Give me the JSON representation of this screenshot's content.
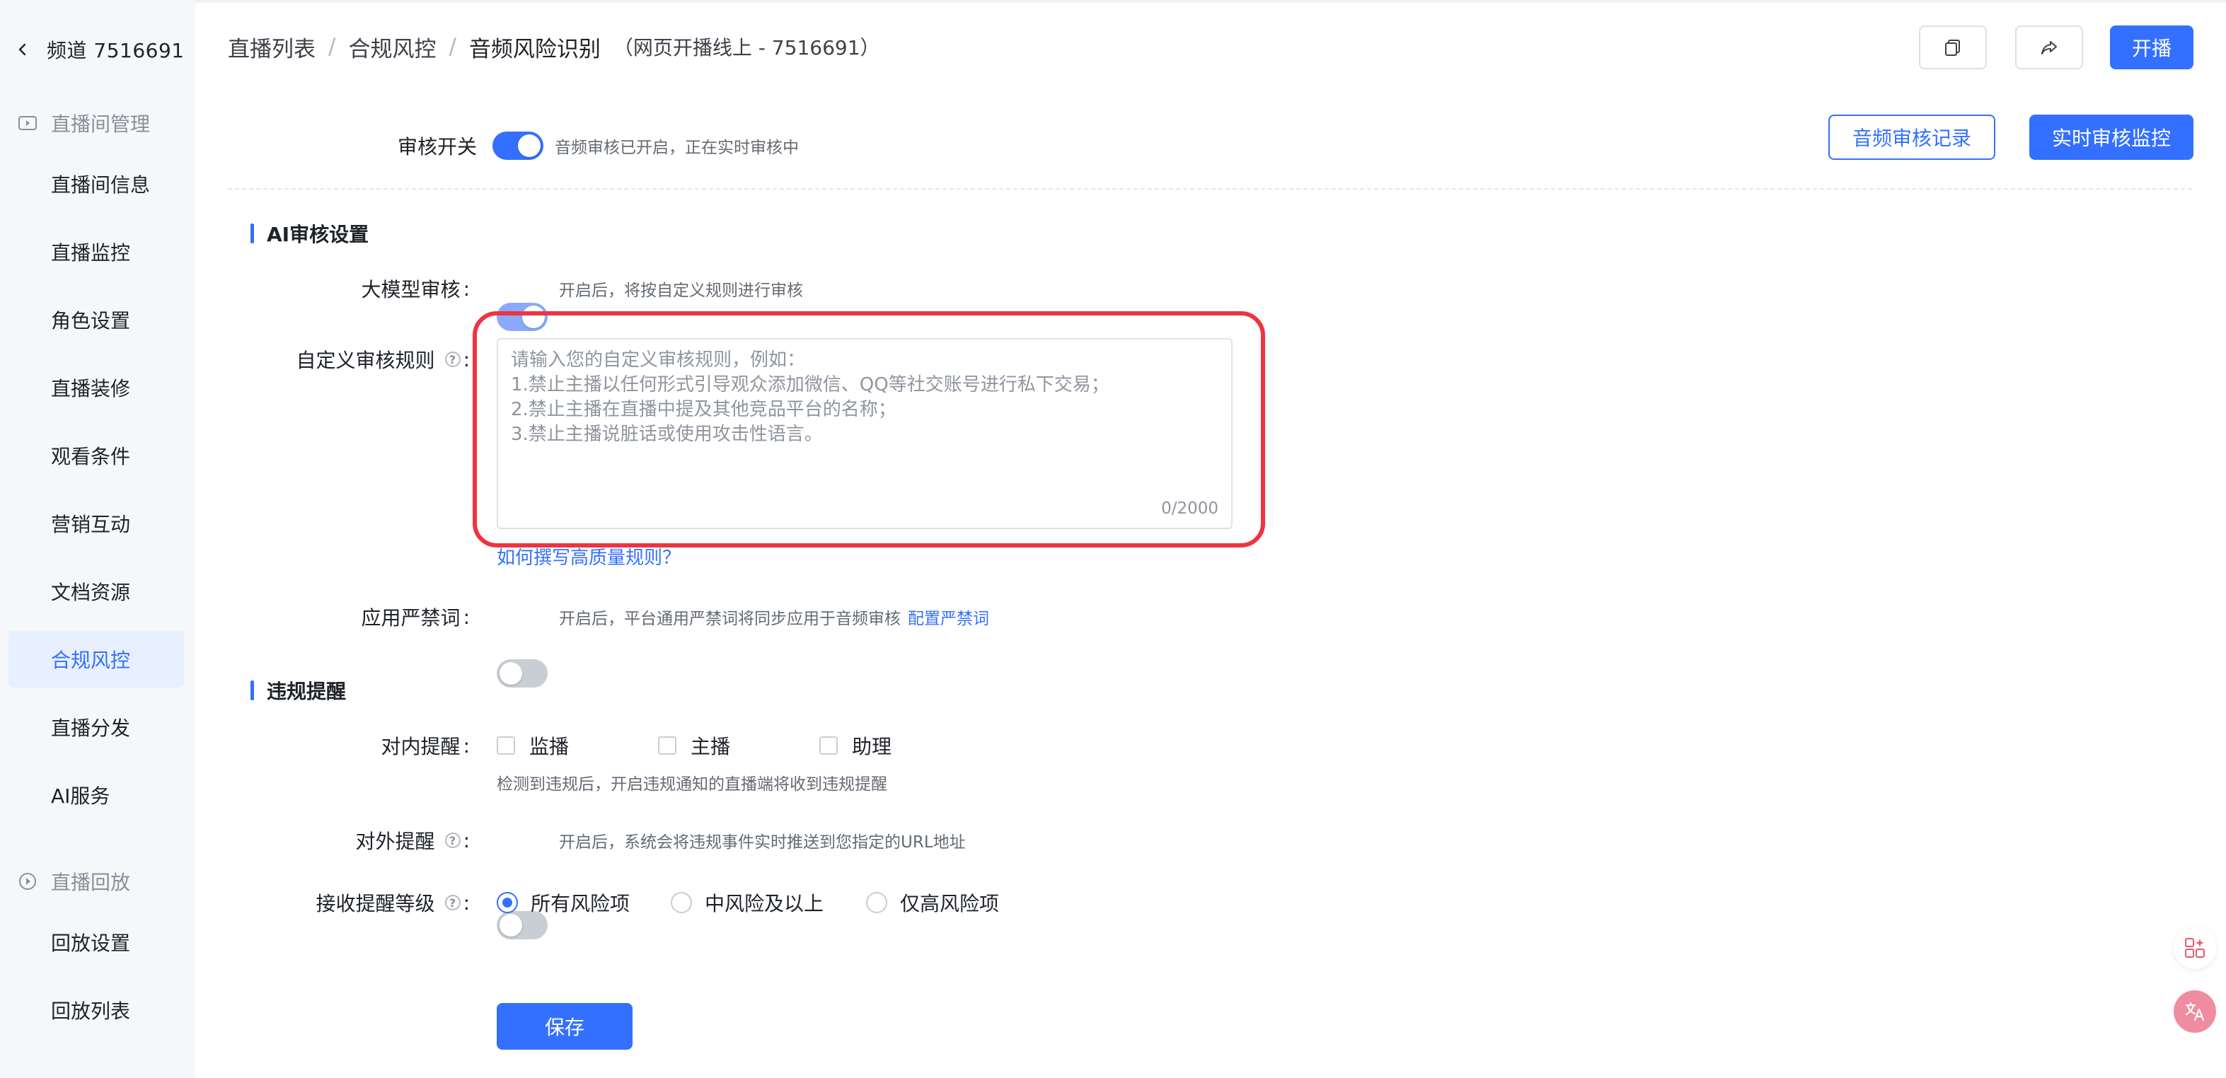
{
  "sidebar": {
    "back_label": "频道 7516691",
    "group1": "直播间管理",
    "items": [
      "直播间信息",
      "直播监控",
      "角色设置",
      "直播装修",
      "观看条件",
      "营销互动",
      "文档资源",
      "合规风控",
      "直播分发",
      "AI服务"
    ],
    "active_item": "合规风控",
    "group2": "直播回放",
    "replay_items": [
      "回放设置",
      "回放列表"
    ]
  },
  "header": {
    "breadcrumb": [
      "直播列表",
      "合规风控",
      "音频风险识别"
    ],
    "subtitle": "（网页开播线上 - 7516691）",
    "start_button": "开播"
  },
  "audit": {
    "switch_label": "审核开关",
    "switch_hint": "音频审核已开启，正在实时审核中",
    "records_button": "音频审核记录",
    "monitor_button": "实时审核监控"
  },
  "ai": {
    "section_title": "AI审核设置",
    "model_label": "大模型审核",
    "model_hint": "开启后，将按自定义规则进行审核",
    "rules_label": "自定义审核规则",
    "rules_placeholder": "请输入您的自定义审核规则，例如：\n1.禁止主播以任何形式引导观众添加微信、QQ等社交账号进行私下交易；\n2.禁止主播在直播中提及其他竞品平台的名称；\n3.禁止主播说脏话或使用攻击性语言。",
    "rules_counter": "0/2000",
    "rules_link": "如何撰写高质量规则？",
    "banned_label": "应用严禁词",
    "banned_hint": "开启后，平台通用严禁词将同步应用于音频审核",
    "banned_link": "配置严禁词"
  },
  "violation": {
    "section_title": "违规提醒",
    "internal_label": "对内提醒",
    "internal_options": [
      "监播",
      "主播",
      "助理"
    ],
    "internal_hint": "检测到违规后，开启违规通知的直播端将收到违规提醒",
    "external_label": "对外提醒",
    "external_hint": "开启后，系统会将违规事件实时推送到您指定的URL地址",
    "level_label": "接收提醒等级",
    "level_options": [
      "所有风险项",
      "中风险及以上",
      "仅高风险项"
    ],
    "level_selected": "所有风险项"
  },
  "save_button": "保存",
  "colors": {
    "accent": "#3370ff",
    "highlight": "#ef3340"
  }
}
